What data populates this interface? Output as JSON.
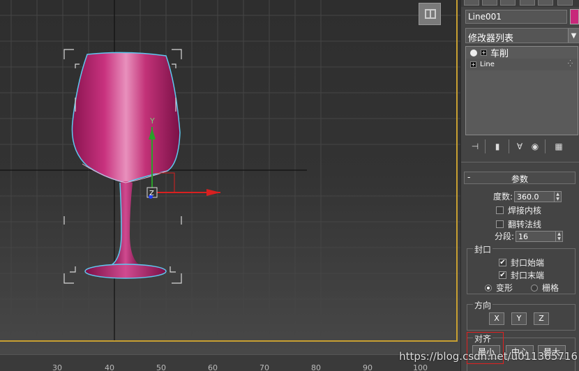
{
  "object_name": "Line001",
  "object_color": "#c8287a",
  "modifier_list": {
    "label": "修改器列表"
  },
  "stack": [
    {
      "label": "车削",
      "type": "modifier"
    },
    {
      "label": "Line",
      "type": "base"
    }
  ],
  "parameters": {
    "title": "参数",
    "degrees_label": "度数:",
    "degrees_value": "360.0",
    "weld_core_label": "焊接内核",
    "flip_normals_label": "翻转法线",
    "segments_label": "分段:",
    "segments_value": "16"
  },
  "capping": {
    "label": "封口",
    "cap_start_label": "封口始端",
    "cap_end_label": "封口末端",
    "morph_label": "变形",
    "grid_label": "栅格"
  },
  "direction": {
    "label": "方向",
    "x": "X",
    "y": "Y",
    "z": "Z"
  },
  "align": {
    "label": "对齐",
    "min": "最小",
    "center": "中心",
    "max": "最大"
  },
  "ruler_ticks": [
    "30",
    "40",
    "50",
    "60",
    "70",
    "80",
    "90",
    "100"
  ],
  "gizmo": {
    "y_label": "Y",
    "z_label": "Z"
  },
  "watermark": "https://blog.csdn.net/u011365716"
}
